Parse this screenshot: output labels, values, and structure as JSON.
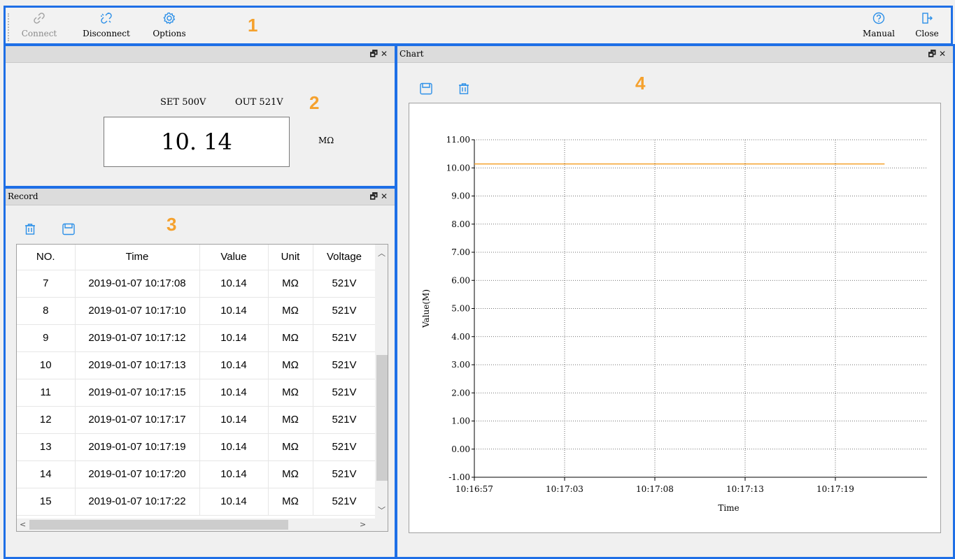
{
  "toolbar": {
    "connect_label": "Connect",
    "disconnect_label": "Disconnect",
    "options_label": "Options",
    "manual_label": "Manual",
    "close_label": "Close",
    "callout": "1"
  },
  "measurement": {
    "title": "",
    "set_text": "SET 500V",
    "out_text": "OUT 521V",
    "value": "10. 14",
    "unit": "MΩ",
    "callout": "2"
  },
  "record": {
    "title": "Record",
    "callout": "3",
    "columns": [
      "NO.",
      "Time",
      "Value",
      "Unit",
      "Voltage"
    ],
    "rows": [
      [
        "7",
        "2019-01-07 10:17:08",
        "10.14",
        "MΩ",
        "521V"
      ],
      [
        "8",
        "2019-01-07 10:17:10",
        "10.14",
        "MΩ",
        "521V"
      ],
      [
        "9",
        "2019-01-07 10:17:12",
        "10.14",
        "MΩ",
        "521V"
      ],
      [
        "10",
        "2019-01-07 10:17:13",
        "10.14",
        "MΩ",
        "521V"
      ],
      [
        "11",
        "2019-01-07 10:17:15",
        "10.14",
        "MΩ",
        "521V"
      ],
      [
        "12",
        "2019-01-07 10:17:17",
        "10.14",
        "MΩ",
        "521V"
      ],
      [
        "13",
        "2019-01-07 10:17:19",
        "10.14",
        "MΩ",
        "521V"
      ],
      [
        "14",
        "2019-01-07 10:17:20",
        "10.14",
        "MΩ",
        "521V"
      ],
      [
        "15",
        "2019-01-07 10:17:22",
        "10.14",
        "MΩ",
        "521V"
      ]
    ]
  },
  "chart_panel": {
    "title": "Chart",
    "callout": "4"
  },
  "chart_data": {
    "type": "line",
    "xlabel": "Time",
    "ylabel": "Value(M)",
    "ylim": [
      -1,
      11
    ],
    "y_ticks": [
      "11.00",
      "10.00",
      "9.00",
      "8.00",
      "7.00",
      "6.00",
      "5.00",
      "4.00",
      "3.00",
      "2.00",
      "1.00",
      "0.00",
      "-1.00"
    ],
    "x_ticks": [
      "10:16:57",
      "10:17:03",
      "10:17:08",
      "10:17:13",
      "10:17:19"
    ],
    "grid": true,
    "series": [
      {
        "color": "#f5a12d",
        "x": [
          "10:16:57",
          "10:17:22"
        ],
        "values": [
          10.14,
          10.14
        ]
      }
    ]
  },
  "colors": {
    "accent_icon": "#2b8fe8",
    "region_border": "#1e6fe6",
    "callout": "#f5a12d"
  }
}
